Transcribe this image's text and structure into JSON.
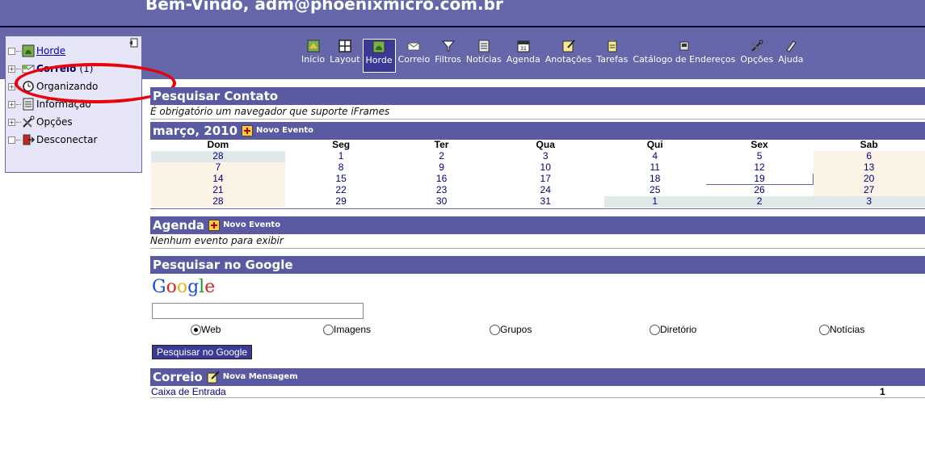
{
  "header": {
    "welcome": "Bem-Vindo, adm@phoenixmicro.com.br"
  },
  "sidebar": {
    "items": [
      {
        "label": "Horde",
        "icon": "horde-icon"
      },
      {
        "label": "Correio",
        "count": "(1)",
        "icon": "mail-icon"
      },
      {
        "label": "Organizando",
        "icon": "organizer-icon"
      },
      {
        "label": "Informação",
        "icon": "info-icon"
      },
      {
        "label": "Opções",
        "icon": "options-icon"
      },
      {
        "label": "Desconectar",
        "icon": "logout-icon"
      }
    ]
  },
  "nav": {
    "items": [
      {
        "label": "Início",
        "icon": "home-icon"
      },
      {
        "label": "Layout",
        "icon": "layout-icon"
      },
      {
        "label": "Horde",
        "icon": "horde-icon",
        "active": true
      },
      {
        "label": "Correio",
        "icon": "mail-icon"
      },
      {
        "label": "Filtros",
        "icon": "filter-icon"
      },
      {
        "label": "Notícias",
        "icon": "news-icon"
      },
      {
        "label": "Agenda",
        "icon": "calendar-icon"
      },
      {
        "label": "Anotações",
        "icon": "notes-icon"
      },
      {
        "label": "Tarefas",
        "icon": "tasks-icon"
      },
      {
        "label": "Catálogo de Endereços",
        "icon": "address-book-icon"
      },
      {
        "label": "Opções",
        "icon": "options-icon"
      },
      {
        "label": "Ajuda",
        "icon": "help-icon"
      }
    ]
  },
  "contact": {
    "title": "Pesquisar Contato",
    "message": "É obrigatório um navegador que suporte iFrames"
  },
  "calendar": {
    "title": "março, 2010",
    "new_event": "Novo Evento",
    "days": [
      "Dom",
      "Seg",
      "Ter",
      "Qua",
      "Qui",
      "Sex",
      "Sab"
    ],
    "weeks": [
      [
        "28",
        "1",
        "2",
        "3",
        "4",
        "5",
        "6"
      ],
      [
        "7",
        "8",
        "9",
        "10",
        "11",
        "12",
        "13"
      ],
      [
        "14",
        "15",
        "16",
        "17",
        "18",
        "19",
        "20"
      ],
      [
        "21",
        "22",
        "23",
        "24",
        "25",
        "26",
        "27"
      ],
      [
        "28",
        "29",
        "30",
        "31",
        "1",
        "2",
        "3"
      ]
    ],
    "today": "19"
  },
  "agenda": {
    "title": "Agenda",
    "new_event": "Novo Evento",
    "empty": "Nenhum evento para exibir"
  },
  "google": {
    "title": "Pesquisar no Google",
    "logo": "Google",
    "options": [
      "Web",
      "Imagens",
      "Grupos",
      "Diretório",
      "Notícias"
    ],
    "selected": "Web",
    "button": "Pesquisar no Google"
  },
  "mail": {
    "title": "Correio",
    "new_message": "Nova Mensagem",
    "inbox": "Caixa de Entrada",
    "inbox_count": "1"
  },
  "colors": {
    "header_bg": "#6666aa",
    "panel_head": "#5a5aa3",
    "callout": "#e8000b"
  }
}
